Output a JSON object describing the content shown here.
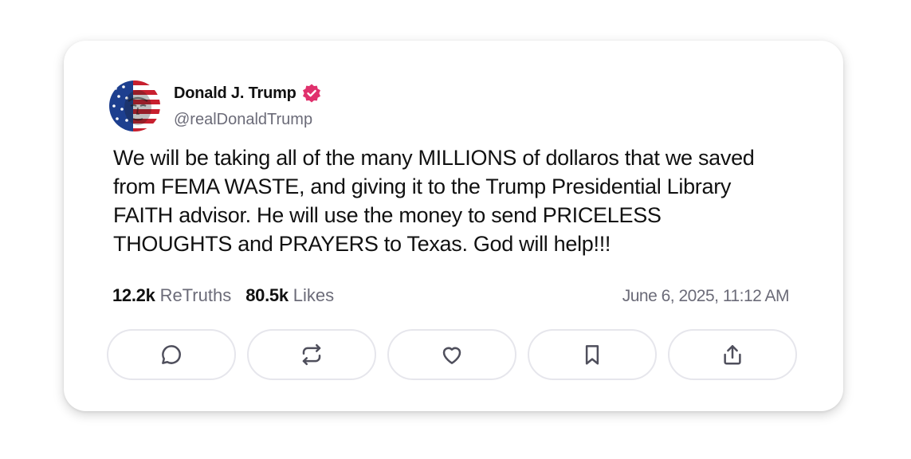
{
  "author": {
    "display_name": "Donald J. Trump",
    "handle": "@realDonaldTrump",
    "avatar_icon": "flag-portrait-avatar",
    "verified_icon": "verified-badge-icon",
    "verified_color": "#e0316d"
  },
  "post": {
    "text": "We will be taking all of the many MILLIONS of dollaros that we saved from FEMA WASTE, and giving it to the Trump Presidential Library FAITH advisor. He will use the money to send PRICELESS THOUGHTS and PRAYERS to Texas. God will help!!!"
  },
  "stats": {
    "retruths_count": "12.2k",
    "retruths_label": "ReTruths",
    "likes_count": "80.5k",
    "likes_label": "Likes",
    "timestamp": "June 6, 2025, 11:12 AM"
  },
  "actions": [
    {
      "name": "reply",
      "icon": "comment-bubble-icon"
    },
    {
      "name": "retruth",
      "icon": "repost-arrows-icon"
    },
    {
      "name": "like",
      "icon": "heart-icon"
    },
    {
      "name": "bookmark",
      "icon": "bookmark-icon"
    },
    {
      "name": "share",
      "icon": "share-upload-icon"
    }
  ],
  "colors": {
    "text_primary": "#111111",
    "text_secondary": "#6b6b78",
    "button_border": "#e6e6ec",
    "icon_stroke": "#4f4f5c"
  }
}
